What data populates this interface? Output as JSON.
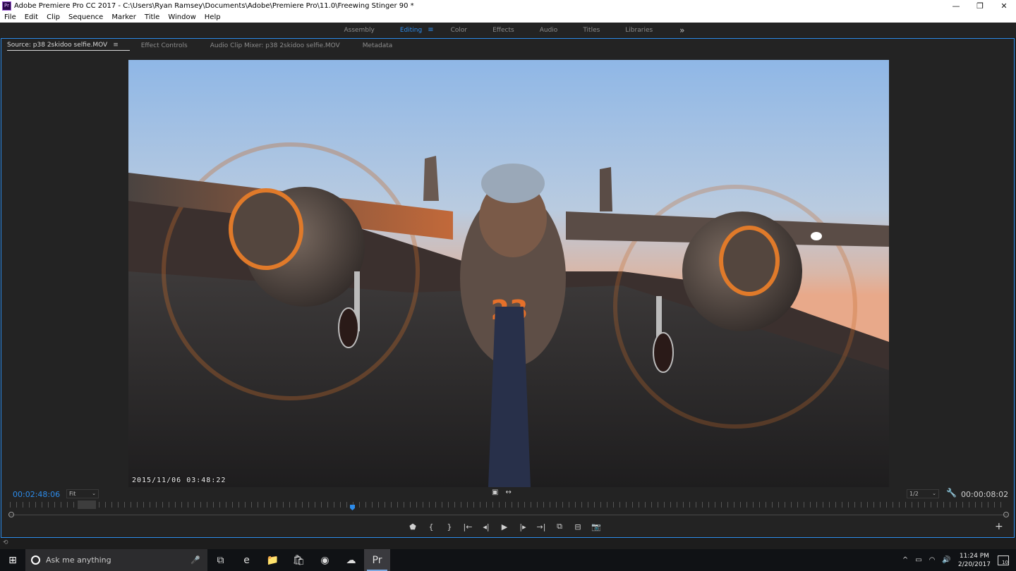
{
  "window": {
    "title": "Adobe Premiere Pro CC 2017 - C:\\Users\\Ryan Ramsey\\Documents\\Adobe\\Premiere Pro\\11.0\\Freewing Stinger 90 *",
    "app_icon_label": "Pr",
    "minimize_glyph": "—",
    "restore_glyph": "❐",
    "close_glyph": "✕"
  },
  "menu": [
    "File",
    "Edit",
    "Clip",
    "Sequence",
    "Marker",
    "Title",
    "Window",
    "Help"
  ],
  "workspaces": {
    "items": [
      "Assembly",
      "Editing",
      "Color",
      "Effects",
      "Audio",
      "Titles",
      "Libraries"
    ],
    "active": "Editing",
    "menu_glyph": "≡",
    "more_glyph": "»"
  },
  "panel": {
    "tabs": [
      "Source: p38 2skidoo selfie.MOV",
      "Effect Controls",
      "Audio Clip Mixer: p38 2skidoo selfie.MOV",
      "Metadata"
    ],
    "active_tab_menu": "≡"
  },
  "video": {
    "timestamp_overlay": "2015/11/06 03:48:22",
    "nose_number": "23"
  },
  "monitor": {
    "playhead_timecode": "00:02:48:06",
    "zoom_value": "Fit",
    "resolution_value": "1/2",
    "duration_timecode": "00:00:08:02",
    "wrench_glyph": "🔧",
    "mid_icons": [
      "▣",
      "↔"
    ]
  },
  "transport": {
    "buttons": [
      {
        "name": "add-marker-button",
        "glyph": "⬟"
      },
      {
        "name": "mark-in-button",
        "glyph": "{"
      },
      {
        "name": "mark-out-button",
        "glyph": "}"
      },
      {
        "name": "go-to-in-button",
        "glyph": "|←"
      },
      {
        "name": "step-back-button",
        "glyph": "◂|"
      },
      {
        "name": "play-button",
        "glyph": "▶"
      },
      {
        "name": "step-forward-button",
        "glyph": "|▸"
      },
      {
        "name": "go-to-out-button",
        "glyph": "→|"
      },
      {
        "name": "insert-button",
        "glyph": "⧉"
      },
      {
        "name": "overwrite-button",
        "glyph": "⊟"
      },
      {
        "name": "export-frame-button",
        "glyph": "📷"
      }
    ],
    "add_glyph": "+"
  },
  "taskbar": {
    "search_placeholder": "Ask me anything",
    "time": "11:24 PM",
    "date": "2/20/2017",
    "notification_count": "10",
    "start_glyph": "⊞",
    "mic_glyph": "🎤",
    "apps": [
      {
        "name": "task-view-icon",
        "glyph": "⧉"
      },
      {
        "name": "edge-icon",
        "glyph": "e"
      },
      {
        "name": "file-explorer-icon",
        "glyph": "📁"
      },
      {
        "name": "store-icon",
        "glyph": "🛍"
      },
      {
        "name": "chrome-icon",
        "glyph": "◉"
      },
      {
        "name": "onedrive-icon",
        "glyph": "☁"
      },
      {
        "name": "premiere-icon",
        "glyph": "Pr"
      }
    ],
    "tray": {
      "chevron": "^",
      "battery": "▭",
      "wifi": "◠",
      "volume": "🔊"
    }
  }
}
